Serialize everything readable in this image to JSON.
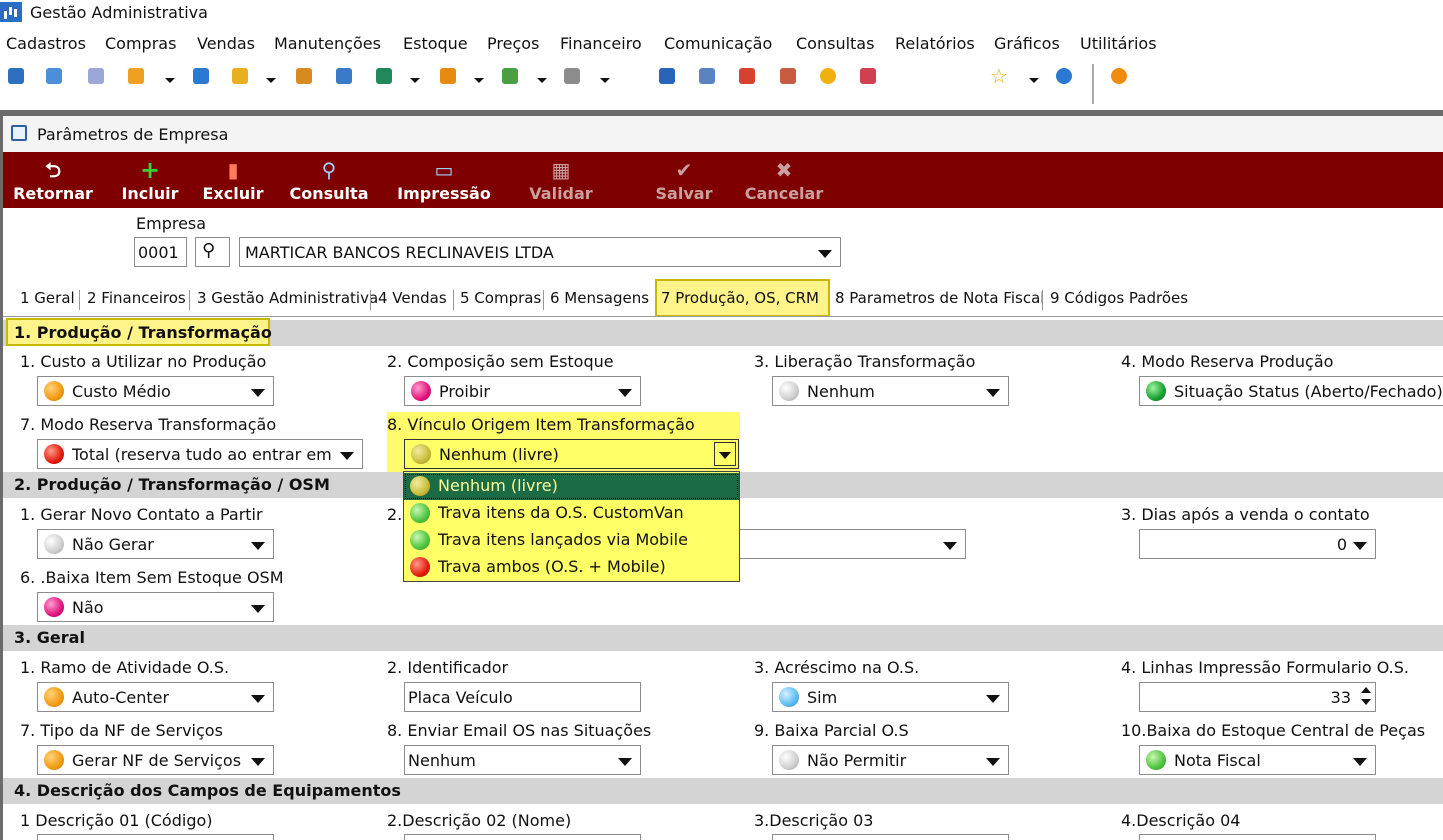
{
  "app": {
    "title": "Gestão Administrativa"
  },
  "menu": [
    "Cadastros",
    "Compras",
    "Vendas",
    "Manutenções",
    "Estoque",
    "Preços",
    "Financeiro",
    "Comunicação",
    "Consultas",
    "Relatórios",
    "Gráficos",
    "Utilitários"
  ],
  "window": {
    "title": "Parâmetros de Empresa"
  },
  "actions": {
    "retornar": "Retornar",
    "incluir": "Incluir",
    "excluir": "Excluir",
    "consulta": "Consulta",
    "impressao": "Impressão",
    "validar": "Validar",
    "salvar": "Salvar",
    "cancelar": "Cancelar"
  },
  "empresa": {
    "label": "Empresa",
    "code": "0001",
    "name": "MARTICAR BANCOS RECLINAVEIS LTDA"
  },
  "tabs": [
    "1 Geral",
    "2 Financeiros",
    "3 Gestão Administrativa",
    "4 Vendas",
    "5 Compras",
    "6 Mensagens",
    "7 Produção, OS, CRM",
    "8 Parametros de Nota Fiscal",
    "9 Códigos Padrões"
  ],
  "sec1": {
    "title": "1. Produção / Transformação",
    "f1_label": "1. Custo a Utilizar no Produção",
    "f1_value": "Custo Médio",
    "f2_label": "2. Composição sem Estoque",
    "f2_value": "Proibir",
    "f3_label": "3. Liberação Transformação",
    "f3_value": "Nenhum",
    "f4_label": "4. Modo Reserva Produção",
    "f4_value": "Situação Status (Aberto/Fechado)",
    "f7_label": "7. Modo Reserva Transformação",
    "f7_value": "Total (reserva tudo ao entrar em '",
    "f8_label": "8. Vínculo Origem Item Transformação",
    "f8_value": "Nenhum (livre)"
  },
  "dropdown_options": [
    "Nenhum (livre)",
    "Trava itens da O.S. CustomVan",
    "Trava itens lançados via Mobile",
    "Trava ambos (O.S. + Mobile)"
  ],
  "sec2": {
    "title": "2. Produção / Transformação / OSM",
    "f1_label": "1. Gerar Novo Contato a Partir",
    "f1_value": "Não Gerar",
    "f2_label_prefix": "2.",
    "f3_label": "3. Dias após a venda o contato",
    "f3_value": "0",
    "f6_label": "6. .Baixa Item Sem Estoque OSM",
    "f6_value": "Não"
  },
  "sec3": {
    "title": "3. Geral",
    "f1_label": "1. Ramo de Atividade O.S.",
    "f1_value": "Auto-Center",
    "f2_label": "2. Identificador",
    "f2_value": "Placa Veículo",
    "f3_label": "3. Acréscimo na O.S.",
    "f3_value": "Sim",
    "f4_label": "4. Linhas Impressão Formulario O.S.",
    "f4_value": "33",
    "f7_label": "7. Tipo da NF de Serviços",
    "f7_value": "Gerar NF de Serviços c",
    "f8_label": "8. Enviar Email OS nas Situações",
    "f8_value": "Nenhum",
    "f9_label": "9. Baixa Parcial O.S",
    "f9_value": "Não Permitir",
    "f10_label": "10.Baixa do Estoque Central de Peças",
    "f10_value": "Nota Fiscal"
  },
  "sec4": {
    "title": "4. Descrição dos Campos de Equipamentos",
    "f1_label": "1 Descrição 01 (Código)",
    "f2_label": "2.Descrição 02 (Nome)",
    "f3_label": "3.Descrição 03",
    "f4_label": "4.Descrição 04"
  }
}
